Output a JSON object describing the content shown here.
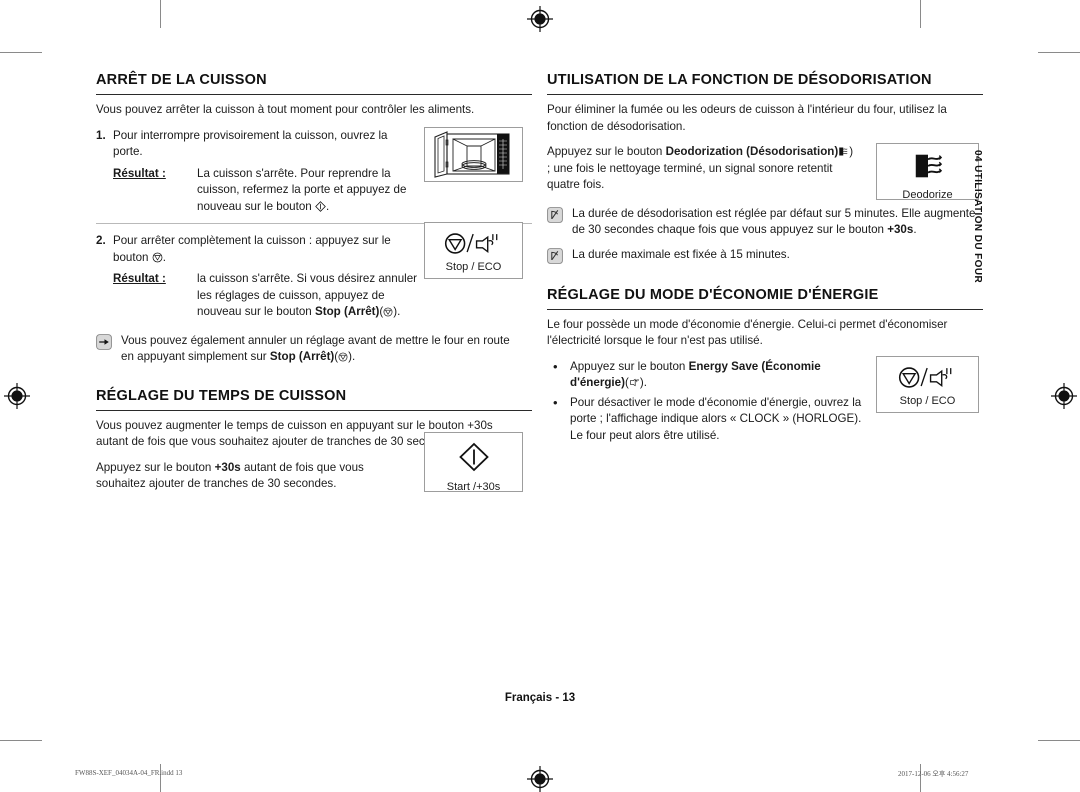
{
  "document": {
    "language": "Français",
    "page_label": "Français - 13",
    "side_tab": "04 UTILISATION DU FOUR",
    "footer_left": "FW88S-XEF_04034A-04_FR.indd   13",
    "footer_right": "2017-12-06   오후 4:56:27"
  },
  "left_column": {
    "section1": {
      "heading": "ARRÊT DE LA CUISSON",
      "intro": "Vous pouvez arrêter la cuisson à tout moment pour contrôler les aliments.",
      "step1": {
        "number": "1.",
        "text": "Pour interrompre provisoirement la cuisson, ouvrez la porte.",
        "result_label": "Résultat :",
        "result_text_a": "La cuisson s'arrête. Pour reprendre la cuisson, refermez la porte et appuyez de nouveau sur le bouton",
        "result_text_b": "."
      },
      "step2": {
        "number": "2.",
        "text_a": "Pour arrêter complètement la cuisson : appuyez sur le bouton",
        "text_b": ".",
        "result_label": "Résultat :",
        "result_text_a": "la cuisson s'arrête. Si vous désirez annuler les réglages de cuisson, appuyez de nouveau sur le bouton",
        "result_bold": "Stop (Arrêt)",
        "result_text_b": "(",
        "result_text_c": ")."
      },
      "note": {
        "text_a": "Vous pouvez également annuler un réglage avant de mettre le four en route en appuyant simplement sur",
        "bold": "Stop (Arrêt)",
        "text_b": "(",
        "text_c": ")."
      }
    },
    "section2": {
      "heading": "RÉGLAGE DU TEMPS DE CUISSON",
      "para1": "Vous pouvez augmenter le temps de cuisson en appuyant sur le bouton +30s autant de fois que vous souhaitez ajouter de tranches de 30 secondes.",
      "para2_a": "Appuyez sur le bouton",
      "para2_bold": "+30s",
      "para2_b": "autant de fois que vous souhaitez ajouter de tranches de 30 secondes."
    }
  },
  "right_column": {
    "section1": {
      "heading": "UTILISATION DE LA FONCTION DE DÉSODORISATION",
      "intro": "Pour éliminer la fumée ou les odeurs de cuisson à l'intérieur du four, utilisez la fonction de désodorisation.",
      "para_a": "Appuyez sur le bouton",
      "para_bold1": "Deodorization",
      "para_bold2": "(Désodorisation)",
      "para_b": ")  ; une fois le nettoyage terminé, un signal sonore retentit quatre fois.",
      "note1_a": "La durée de désodorisation est réglée par défaut sur 5 minutes. Elle augmente de 30 secondes chaque fois que vous appuyez sur le bouton",
      "note1_bold": "+30s",
      "note1_b": ".",
      "note2": "La durée maximale est fixée à 15 minutes."
    },
    "section2": {
      "heading": "RÉGLAGE DU MODE D'ÉCONOMIE D'ÉNERGIE",
      "intro": "Le four possède un mode d'économie d'énergie. Celui-ci permet d'économiser l'électricité lorsque le four n'est pas utilisé.",
      "bullet1_a": "Appuyez sur le bouton",
      "bullet1_bold1": "Energy Save (Économie",
      "bullet1_bold2": "d'énergie)",
      "bullet1_b": "(",
      "bullet1_c": ").",
      "bullet2": "Pour désactiver le mode d'économie d'énergie, ouvrez la porte ; l'affichage indique alors « CLOCK » (HORLOGE). Le four peut alors être utilisé."
    }
  },
  "figures": {
    "oven": {
      "name": "microwave-oven-open-door"
    },
    "stop_eco_1": {
      "caption": "Stop / ECO"
    },
    "start_30s": {
      "caption": "Start /+30s"
    },
    "deodorize": {
      "caption": "Deodorize"
    },
    "stop_eco_2": {
      "caption": "Stop / ECO"
    }
  },
  "colors": {
    "text": "#1a1a1a",
    "rule": "#2a2a2a",
    "hairline": "#b9b9b9",
    "box_border": "#9d9d9d",
    "crop_mark": "#8a8a8a"
  }
}
